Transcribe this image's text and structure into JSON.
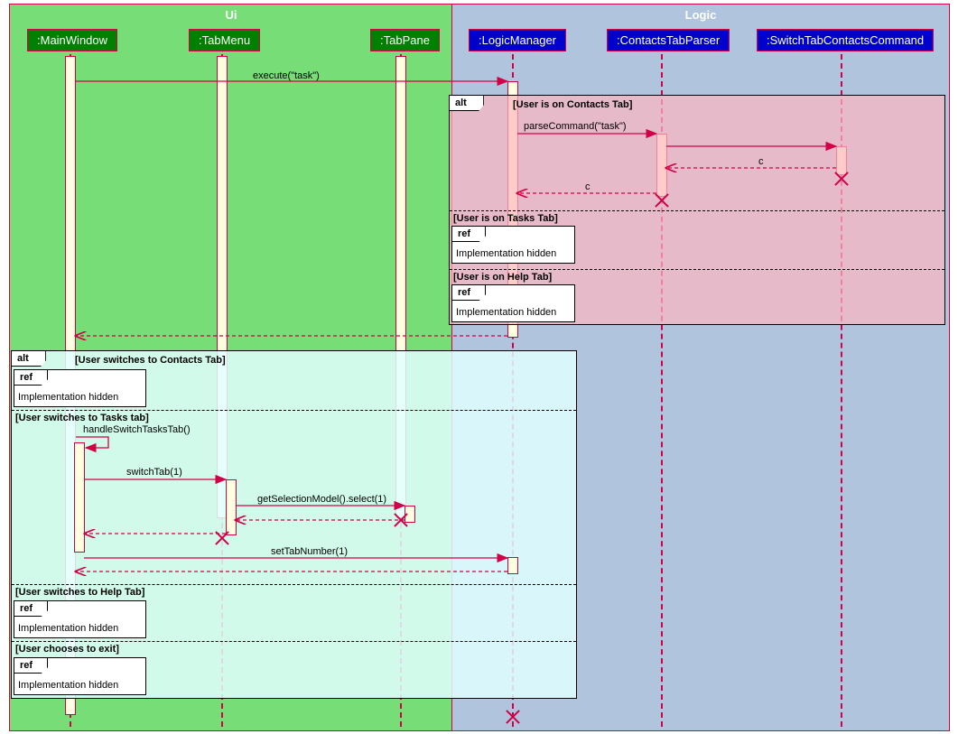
{
  "groups": {
    "ui": "Ui",
    "logic": "Logic"
  },
  "participants": {
    "mainWindow": ":MainWindow",
    "tabMenu": ":TabMenu",
    "tabPane": ":TabPane",
    "logicManager": ":LogicManager",
    "contactsTabParser": ":ContactsTabParser",
    "switchTabContactsCommand": ":SwitchTabContactsCommand"
  },
  "frags": {
    "altTop": "alt",
    "altBottom": "alt",
    "ref": "ref"
  },
  "guards": {
    "contactsTab": "[User is on Contacts Tab]",
    "tasksTab": "[User is on Tasks Tab]",
    "helpTab": "[User is on Help Tab]",
    "switchContacts": "[User switches to Contacts Tab]",
    "switchTasks": "[User switches to Tasks tab]",
    "switchHelp": "[User switches to Help Tab]",
    "exit": "[User chooses to exit]"
  },
  "refText": "Implementation hidden",
  "msgs": {
    "execute": "execute(\"task\")",
    "parseCommand": "parseCommand(\"task\")",
    "c": "c",
    "handleSwitch": "handleSwitchTasksTab()",
    "switchTab": "switchTab(1)",
    "getSelection": "getSelectionModel().select(1)",
    "setTabNumber": "setTabNumber(1)"
  },
  "chart_data": {
    "type": "uml-sequence-diagram",
    "groups": [
      {
        "name": "Ui",
        "participants": [
          ":MainWindow",
          ":TabMenu",
          ":TabPane"
        ]
      },
      {
        "name": "Logic",
        "participants": [
          ":LogicManager",
          ":ContactsTabParser",
          ":SwitchTabContactsCommand"
        ]
      }
    ],
    "messages": [
      {
        "from": ":MainWindow",
        "to": ":LogicManager",
        "label": "execute(\"task\")",
        "type": "sync"
      },
      {
        "fragment": "alt",
        "guard": "[User is on Contacts Tab]",
        "messages": [
          {
            "from": ":LogicManager",
            "to": ":ContactsTabParser",
            "label": "parseCommand(\"task\")",
            "type": "sync"
          },
          {
            "from": ":ContactsTabParser",
            "to": ":SwitchTabContactsCommand",
            "type": "sync"
          },
          {
            "from": ":SwitchTabContactsCommand",
            "to": ":ContactsTabParser",
            "label": "c",
            "type": "return"
          },
          {
            "destroy": ":SwitchTabContactsCommand"
          },
          {
            "from": ":ContactsTabParser",
            "to": ":LogicManager",
            "label": "c",
            "type": "return"
          },
          {
            "destroy": ":ContactsTabParser"
          }
        ]
      },
      {
        "fragment": "alt-else",
        "guard": "[User is on Tasks Tab]",
        "ref": "Implementation hidden"
      },
      {
        "fragment": "alt-else",
        "guard": "[User is on Help Tab]",
        "ref": "Implementation hidden"
      },
      {
        "from": ":LogicManager",
        "to": ":MainWindow",
        "type": "return"
      },
      {
        "fragment": "alt",
        "guard": "[User switches to Contacts Tab]",
        "ref": "Implementation hidden"
      },
      {
        "fragment": "alt-else",
        "guard": "[User switches to Tasks tab]",
        "messages": [
          {
            "from": ":MainWindow",
            "to": ":MainWindow",
            "label": "handleSwitchTasksTab()",
            "type": "self"
          },
          {
            "from": ":MainWindow",
            "to": ":TabMenu",
            "label": "switchTab(1)",
            "type": "sync"
          },
          {
            "from": ":TabMenu",
            "to": ":TabPane",
            "label": "getSelectionModel().select(1)",
            "type": "sync"
          },
          {
            "from": ":TabPane",
            "to": ":TabMenu",
            "type": "return"
          },
          {
            "destroy": ":TabPane"
          },
          {
            "from": ":TabMenu",
            "to": ":MainWindow",
            "type": "return"
          },
          {
            "destroy": ":TabMenu"
          },
          {
            "from": ":MainWindow",
            "to": ":LogicManager",
            "label": "setTabNumber(1)",
            "type": "sync"
          },
          {
            "from": ":LogicManager",
            "to": ":MainWindow",
            "type": "return"
          }
        ]
      },
      {
        "fragment": "alt-else",
        "guard": "[User switches to Help Tab]",
        "ref": "Implementation hidden"
      },
      {
        "fragment": "alt-else",
        "guard": "[User chooses to exit]",
        "ref": "Implementation hidden"
      },
      {
        "destroy": ":LogicManager"
      }
    ]
  }
}
